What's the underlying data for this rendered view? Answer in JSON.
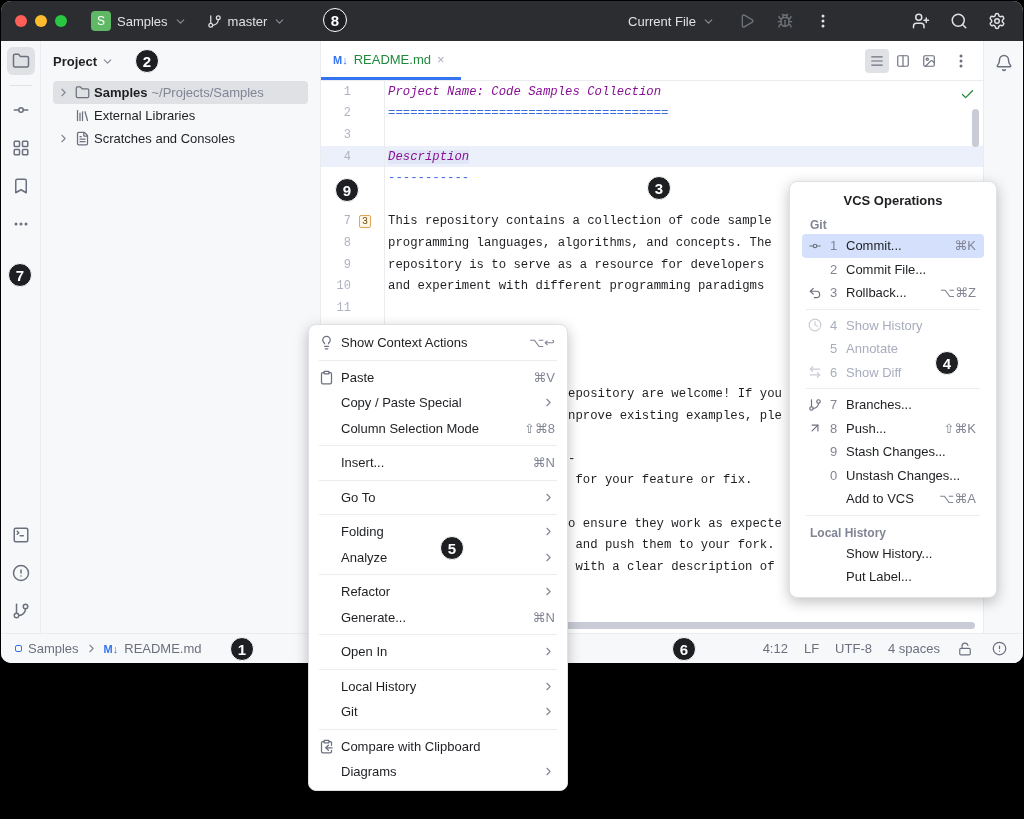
{
  "title_bar": {
    "project_badge": "S",
    "project": "Samples",
    "branch": "master",
    "run_config": "Current File"
  },
  "project_panel": {
    "title": "Project",
    "tree": [
      {
        "label": "Samples",
        "path": "~/Projects/Samples",
        "has_children": true,
        "expanded": false,
        "selected": true
      },
      {
        "label": "External Libraries",
        "selected": false
      },
      {
        "label": "Scratches and Consoles",
        "has_children": true,
        "expanded": false,
        "selected": false
      }
    ]
  },
  "editor": {
    "tab": {
      "icon_text": "M↓",
      "label": "README.md",
      "close": "×",
      "selected": true
    },
    "view_modes": [
      {
        "selected": true
      },
      {
        "selected": false
      },
      {
        "selected": false
      }
    ],
    "lines": [
      {
        "number": "1",
        "kind": "heading",
        "text": "Project Name: Code Samples Collection",
        "current": false
      },
      {
        "number": "2",
        "kind": "rule",
        "text": "======================================",
        "current": false
      },
      {
        "number": "3",
        "kind": "blank",
        "current": false
      },
      {
        "number": "4",
        "kind": "heading",
        "text": "Description",
        "current": true
      },
      {
        "kind": "rule",
        "text": "-----------",
        "current": false
      },
      {
        "kind": "blank",
        "current": false
      },
      {
        "number": "7",
        "badge": "3",
        "kind": "plain",
        "text": "This repository contains a collection of code sample",
        "current": false
      },
      {
        "number": "8",
        "kind": "plain",
        "text": "programming languages, algorithms, and concepts. The",
        "current": false
      },
      {
        "number": "9",
        "kind": "plain",
        "text": "repository is to serve as a resource for developers",
        "current": false
      },
      {
        "number": "10",
        "kind": "plain",
        "text": "and experiment with different programming paradigms",
        "current": false
      },
      {
        "number": "11",
        "kind": "blank",
        "current": false
      },
      {
        "kind": "blank",
        "current": false
      },
      {
        "kind": "blank",
        "current": false
      },
      {
        "kind": "blank",
        "current": false
      },
      {
        "kind": "covered",
        "text": "epository are welcome! If you",
        "current": false
      },
      {
        "kind": "covered",
        "text": "nprove existing examples, ple",
        "current": false
      },
      {
        "kind": "blank",
        "current": false
      },
      {
        "kind": "covered",
        "text": "-",
        "current": false
      },
      {
        "kind": "covered",
        "text": " for your feature or fix.",
        "current": false
      },
      {
        "kind": "blank",
        "current": false
      },
      {
        "kind": "covered",
        "text": "o ensure they work as expecte",
        "current": false
      },
      {
        "kind": "covered",
        "text": " and push them to your fork.",
        "current": false
      },
      {
        "kind": "covered",
        "text": " with a clear description of",
        "current": false
      }
    ]
  },
  "status_bar": {
    "breadcrumbs": [
      {
        "label": "Samples"
      },
      {
        "icon_text": "M↓",
        "label": "README.md"
      }
    ],
    "items": [
      "4:12",
      "LF",
      "UTF-8",
      "4 spaces"
    ]
  },
  "context_menu": {
    "groups": [
      [
        {
          "label": "Show Context Actions",
          "shortcut": "⌥↩",
          "submenu": false
        }
      ],
      [
        {
          "label": "Paste",
          "shortcut": "⌘V",
          "submenu": false
        },
        {
          "label": "Copy / Paste Special",
          "submenu": true
        },
        {
          "label": "Column Selection Mode",
          "shortcut": "⇧⌘8",
          "submenu": false
        }
      ],
      [
        {
          "label": "Insert...",
          "shortcut": "⌘N",
          "submenu": false
        }
      ],
      [
        {
          "label": "Go To",
          "submenu": true
        }
      ],
      [
        {
          "label": "Folding",
          "submenu": true
        },
        {
          "label": "Analyze",
          "submenu": true
        }
      ],
      [
        {
          "label": "Refactor",
          "submenu": true
        },
        {
          "label": "Generate...",
          "shortcut": "⌘N",
          "submenu": false
        }
      ],
      [
        {
          "label": "Open In",
          "submenu": true
        }
      ],
      [
        {
          "label": "Local History",
          "submenu": true
        },
        {
          "label": "Git",
          "submenu": true
        }
      ],
      [
        {
          "label": "Compare with Clipboard",
          "submenu": false
        },
        {
          "label": "Diagrams",
          "submenu": true
        }
      ]
    ]
  },
  "vcs_popup": {
    "title": "VCS Operations",
    "sections": [
      {
        "title": "Git",
        "groups": [
          [
            {
              "number": "1",
              "label": "Commit...",
              "shortcut": "⌘K",
              "selected": true,
              "disabled": false
            },
            {
              "number": "2",
              "label": "Commit File...",
              "selected": false,
              "disabled": false
            },
            {
              "number": "3",
              "label": "Rollback...",
              "shortcut": "⌥⌘Z",
              "selected": false,
              "disabled": false
            }
          ],
          [
            {
              "number": "4",
              "label": "Show History",
              "selected": false,
              "disabled": true
            },
            {
              "number": "5",
              "label": "Annotate",
              "selected": false,
              "disabled": true
            },
            {
              "number": "6",
              "label": "Show Diff",
              "selected": false,
              "disabled": true
            }
          ],
          [
            {
              "number": "7",
              "label": "Branches...",
              "selected": false,
              "disabled": false
            },
            {
              "number": "8",
              "label": "Push...",
              "shortcut": "⇧⌘K",
              "selected": false,
              "disabled": false
            },
            {
              "number": "9",
              "label": "Stash Changes...",
              "selected": false,
              "disabled": false
            },
            {
              "number": "0",
              "label": "Unstash Changes...",
              "selected": false,
              "disabled": false
            },
            {
              "label": "Add to VCS",
              "shortcut": "⌥⌘A",
              "selected": false,
              "disabled": false
            }
          ]
        ]
      },
      {
        "title": "Local History",
        "groups": [
          [
            {
              "label": "Show History...",
              "selected": false,
              "disabled": false
            },
            {
              "label": "Put Label...",
              "selected": false,
              "disabled": false
            }
          ]
        ]
      }
    ]
  },
  "callouts": [
    "8",
    "2",
    "3",
    "9",
    "7",
    "4",
    "5",
    "1",
    "6"
  ]
}
